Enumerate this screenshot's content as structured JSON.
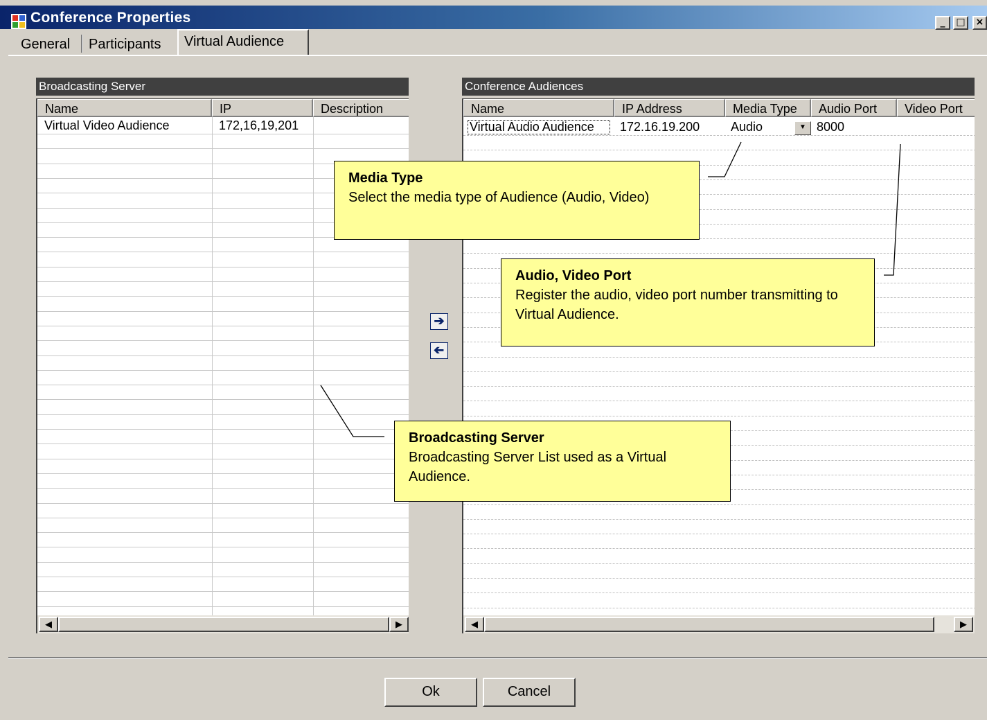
{
  "window": {
    "title": "Conference Properties",
    "minimize": "_",
    "maximize": "□",
    "close": "×"
  },
  "tabs": [
    {
      "label": "General"
    },
    {
      "label": "Participants"
    },
    {
      "label": "Virtual Audience",
      "active": true
    }
  ],
  "broadcasting_server": {
    "title": "Broadcasting Server",
    "columns": [
      "Name",
      "IP",
      "Description"
    ],
    "rows": [
      {
        "name": "Virtual Video Audience",
        "ip": "172,16,19,201",
        "description": ""
      }
    ]
  },
  "conference_audiences": {
    "title": "Conference Audiences",
    "columns": [
      "Name",
      "IP Address",
      "Media Type",
      "Audio Port",
      "Video Port"
    ],
    "rows": [
      {
        "name": "Virtual Audio Audience",
        "ip": "172.16.19.200",
        "media_type": "Audio",
        "audio_port": "8000",
        "video_port": ""
      }
    ]
  },
  "move_buttons": {
    "add_icon": "arrow-right-icon",
    "remove_icon": "arrow-left-icon"
  },
  "callouts": {
    "media_type": {
      "title": "Media Type",
      "body": "Select the media type of Audience (Audio, Video)"
    },
    "ports": {
      "title": "Audio, Video Port",
      "body": "Register the audio, video port number transmitting to Virtual Audience."
    },
    "broadcasting": {
      "title": "Broadcasting Server",
      "body": "Broadcasting Server List used as a Virtual Audience."
    }
  },
  "buttons": {
    "ok": "Ok",
    "cancel": "Cancel"
  }
}
